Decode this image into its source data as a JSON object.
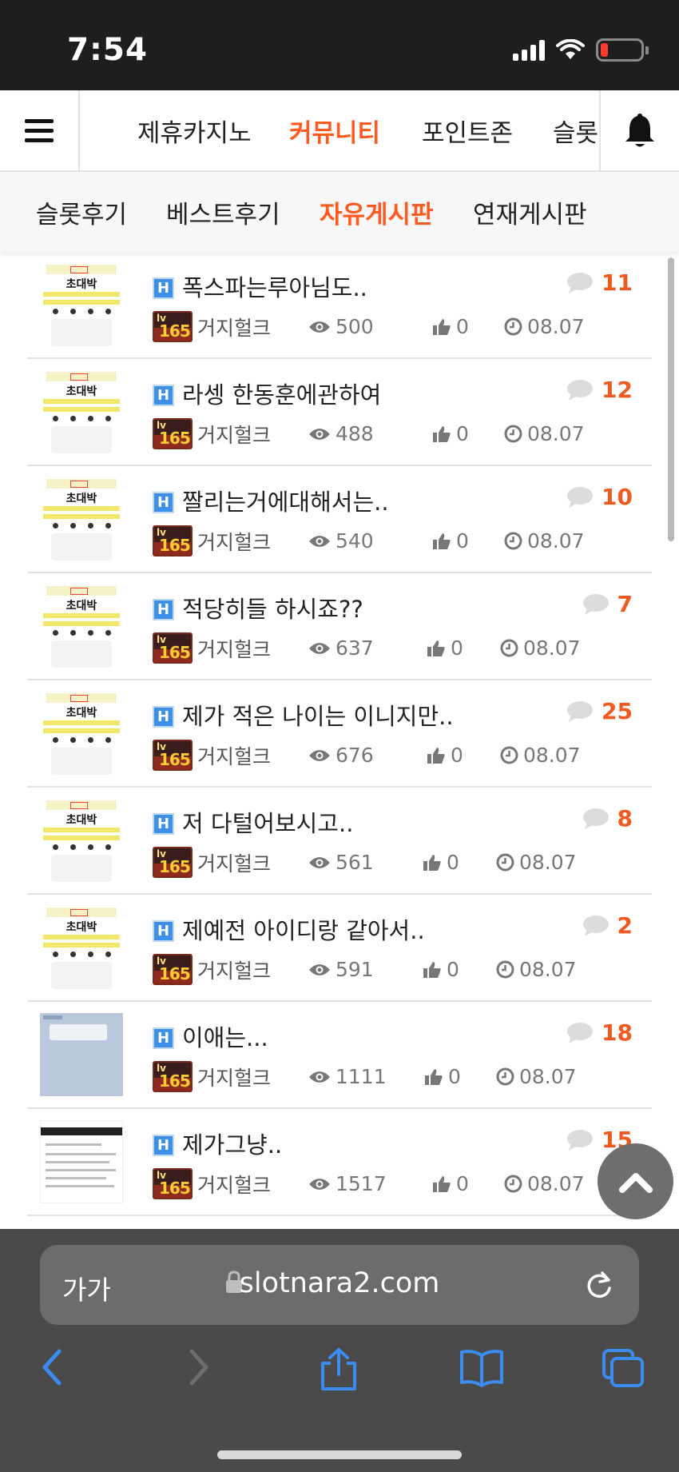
{
  "status_bar": {
    "time": "7:54"
  },
  "top_nav": {
    "tabs": [
      {
        "label": "제휴카지노",
        "active": false
      },
      {
        "label": "커뮤니티",
        "active": true
      },
      {
        "label": "포인트존",
        "active": false
      },
      {
        "label": "슬롯",
        "active": false
      }
    ]
  },
  "sub_nav": {
    "tabs": [
      {
        "label": "슬롯후기",
        "active": false
      },
      {
        "label": "베스트후기",
        "active": false
      },
      {
        "label": "자유게시판",
        "active": true
      },
      {
        "label": "연재게시판",
        "active": false
      }
    ]
  },
  "thumbnail_text": {
    "poster_title": "초대박"
  },
  "level_badge": {
    "lv": "lv",
    "level": "165"
  },
  "posts": [
    {
      "title": "폭스파는루아님도..",
      "comments": "11",
      "author": "거지헐크",
      "views": "500",
      "likes": "0",
      "date": "08.07",
      "thumb": "poster"
    },
    {
      "title": "라셍 한동훈에관하여",
      "comments": "12",
      "author": "거지헐크",
      "views": "488",
      "likes": "0",
      "date": "08.07",
      "thumb": "poster"
    },
    {
      "title": "짤리는거에대해서는..",
      "comments": "10",
      "author": "거지헐크",
      "views": "540",
      "likes": "0",
      "date": "08.07",
      "thumb": "poster"
    },
    {
      "title": "적당히들 하시죠??",
      "comments": "7",
      "author": "거지헐크",
      "views": "637",
      "likes": "0",
      "date": "08.07",
      "thumb": "poster"
    },
    {
      "title": "제가 적은 나이는 이니지만..",
      "comments": "25",
      "author": "거지헐크",
      "views": "676",
      "likes": "0",
      "date": "08.07",
      "thumb": "poster"
    },
    {
      "title": "저 다털어보시고..",
      "comments": "8",
      "author": "거지헐크",
      "views": "561",
      "likes": "0",
      "date": "08.07",
      "thumb": "poster"
    },
    {
      "title": "제예전 아이디랑 같아서..",
      "comments": "2",
      "author": "거지헐크",
      "views": "591",
      "likes": "0",
      "date": "08.07",
      "thumb": "poster"
    },
    {
      "title": "이애는...",
      "comments": "18",
      "author": "거지헐크",
      "views": "1111",
      "likes": "0",
      "date": "08.07",
      "thumb": "chat"
    },
    {
      "title": "제가그냥..",
      "comments": "15",
      "author": "거지헐크",
      "views": "1517",
      "likes": "0",
      "date": "08.07",
      "thumb": "doc"
    }
  ],
  "browser": {
    "text_size_label": "가가",
    "url": "slotnara2.com"
  },
  "colors": {
    "accent": "#ff5a1f",
    "comment_count": "#f05a20",
    "h_icon": "#3d8fe8",
    "browser_bar": "#4a4a4a",
    "ios_blue": "#3b8cf0"
  }
}
